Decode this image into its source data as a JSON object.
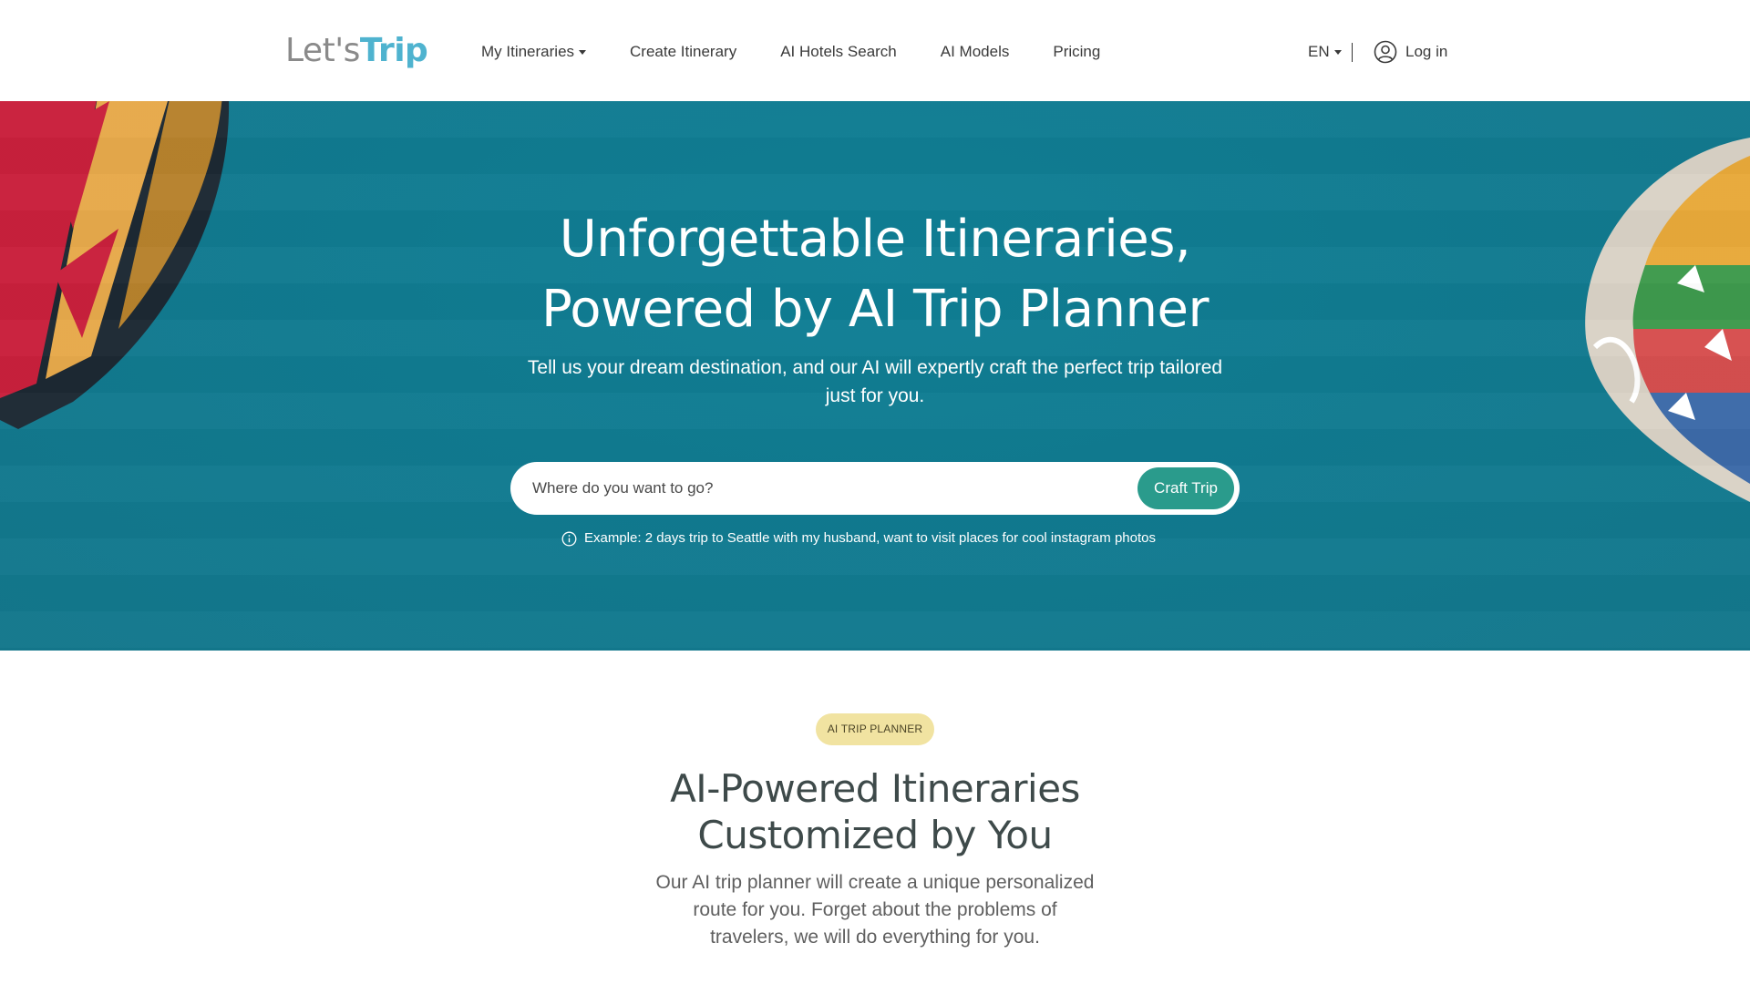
{
  "brand": {
    "logo_part1": "Let's",
    "logo_part2": "Trip",
    "logo_color_1": "#8a8a8a",
    "logo_color_2": "#4fb3cf"
  },
  "nav": {
    "items": [
      {
        "label": "My Itineraries",
        "has_dropdown": true
      },
      {
        "label": "Create Itinerary",
        "has_dropdown": false
      },
      {
        "label": "AI Hotels Search",
        "has_dropdown": false
      },
      {
        "label": "AI Models",
        "has_dropdown": false
      },
      {
        "label": "Pricing",
        "has_dropdown": false
      }
    ],
    "language": "EN",
    "login_label": "Log in",
    "login_icon": "user-circle-icon"
  },
  "hero": {
    "title": "Unforgettable Itineraries, Powered by AI Trip Planner",
    "subtitle": "Tell us your dream destination, and our AI will expertly craft the perfect trip tailored just for you.",
    "search": {
      "placeholder": "Where do you want to go?",
      "value": "",
      "button_label": "Craft Trip"
    },
    "example_icon": "info-icon",
    "example_text": "Example: 2 days trip to Seattle with my husband, want to visit places for cool instagram photos",
    "background_color": "#107b91",
    "button_color": "#2a9b8c"
  },
  "section": {
    "badge": "AI TRIP PLANNER",
    "badge_color": "#f1e3a1",
    "title": "AI-Powered Itineraries Customized by You",
    "description": "Our AI trip planner will create a unique personalized route for you. Forget about the problems of travelers, we will do everything for you."
  }
}
